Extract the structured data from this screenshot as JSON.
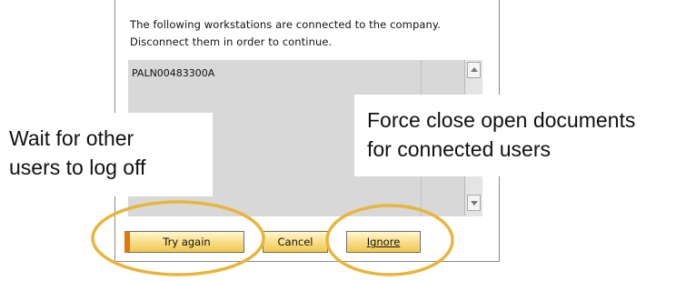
{
  "dialog": {
    "message_line1": "The following workstations are connected to the company.",
    "message_line2": "Disconnect them in order to continue.",
    "workstations": [
      "PALN00483300A"
    ]
  },
  "buttons": {
    "try_again": "Try again",
    "cancel": "Cancel",
    "ignore": "Ignore"
  },
  "callouts": {
    "left_line1": "Wait for other",
    "left_line2": "users to log off",
    "right_line1": "Force close open documents",
    "right_line2": "for connected users"
  },
  "colors": {
    "highlight_ring": "#e9b43a",
    "button_accent": "#e07a10",
    "list_background": "#d8d8d8"
  },
  "icons": {
    "scroll_up": "scroll-up-arrow-icon",
    "scroll_down": "scroll-down-arrow-icon"
  }
}
